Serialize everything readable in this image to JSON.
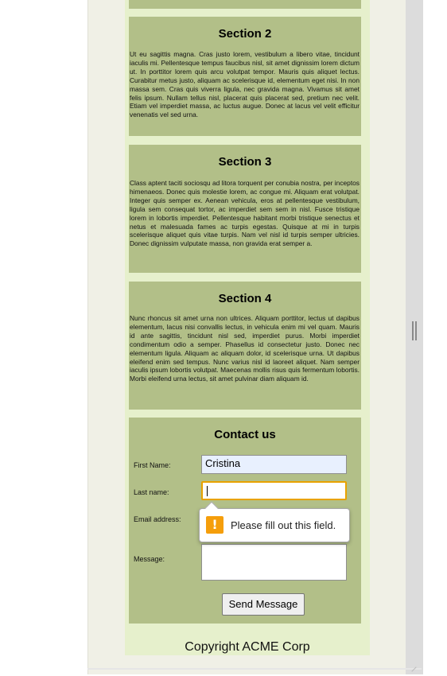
{
  "sections": [
    {
      "title": "Section 2",
      "body": "Ut eu sagittis magna. Cras justo lorem, vestibulum a libero vitae, tincidunt iaculis mi. Pellentesque tempus faucibus nisl, sit amet dignissim lorem dictum ut. In porttitor lorem quis arcu volutpat tempor. Mauris quis aliquet lectus. Curabitur metus justo, aliquam ac scelerisque id, elementum eget nisi. In non massa sem. Cras quis viverra ligula, nec gravida magna. Vivamus sit amet felis ipsum. Nullam tellus nisl, placerat quis placerat sed, pretium nec velit. Etiam vel imperdiet massa, ac luctus augue. Donec at lacus vel velit efficitur venenatis vel sed urna."
    },
    {
      "title": "Section 3",
      "body": "Class aptent taciti sociosqu ad litora torquent per conubia nostra, per inceptos himenaeos. Donec quis molestie lorem, ac congue mi. Aliquam erat volutpat. Integer quis semper ex. Aenean vehicula, eros at pellentesque vestibulum, ligula sem consequat tortor, ac imperdiet sem sem in nisl. Fusce tristique lorem in lobortis imperdiet. Pellentesque habitant morbi tristique senectus et netus et malesuada fames ac turpis egestas. Quisque at mi in turpis scelerisque aliquet quis vitae turpis. Nam vel nisl id turpis semper ultricies. Donec dignissim vulputate massa, non gravida erat semper a."
    },
    {
      "title": "Section 4",
      "body": "Nunc rhoncus sit amet urna non ultrices. Aliquam porttitor, lectus ut dapibus elementum, lacus nisi convallis lectus, in vehicula enim mi vel quam. Mauris id ante sagittis, tincidunt nisl sed, imperdiet purus. Morbi imperdiet condimentum odio a semper. Phasellus id consectetur justo. Donec nec elementum ligula. Aliquam ac aliquam dolor, id scelerisque urna. Ut dapibus eleifend enim sed tempus. Nunc varius nisl id laoreet aliquet. Nam semper iaculis ipsum lobortis volutpat. Maecenas mollis risus quis fermentum lobortis. Morbi eleifend urna lectus, sit amet pulvinar diam aliquam id."
    }
  ],
  "contact": {
    "title": "Contact us",
    "first_name_label": "First Name:",
    "first_name_value": "Cristina",
    "last_name_label": "Last name:",
    "last_name_value": "",
    "email_label": "Email address:",
    "message_label": "Message:",
    "send_label": "Send Message"
  },
  "validation_tooltip": {
    "icon": "warning-icon",
    "icon_glyph": "!",
    "text": "Please fill out this field."
  },
  "footer": {
    "copyright": "Copyright ACME Corp"
  },
  "colors": {
    "section_bg": "#b2bf88",
    "page_bg": "#e6f0cc",
    "outer_bg": "#f0f0e6",
    "focus_border": "#e8a200",
    "warning": "#f59e0b",
    "autofill_bg": "#e8f0fe"
  }
}
